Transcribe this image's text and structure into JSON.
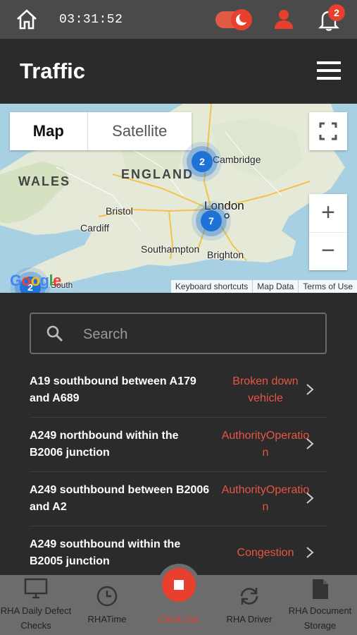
{
  "status_bar": {
    "time": "03:31:52",
    "notification_count": "2"
  },
  "header": {
    "title": "Traffic"
  },
  "map": {
    "tabs": [
      "Map",
      "Satellite"
    ],
    "labels": {
      "wales": "WALES",
      "england": "ENGLAND",
      "cambridge": "Cambridge",
      "london": "London",
      "bristol": "Bristol",
      "cardiff": "Cardiff",
      "southampton": "Southampton",
      "brighton": "Brighton",
      "south": "South"
    },
    "clusters": [
      "2",
      "7",
      "2"
    ],
    "attribution": [
      "Keyboard shortcuts",
      "Map Data",
      "Terms of Use"
    ],
    "logo": "Google"
  },
  "search": {
    "placeholder": "Search"
  },
  "incidents": [
    {
      "road": "A19 southbound between A179 and A689",
      "status": "Broken down vehicle"
    },
    {
      "road": "A249 northbound within the B2006 junction",
      "status": "AuthorityOperation"
    },
    {
      "road": "A249 southbound between B2006 and A2",
      "status": "AuthorityOperation"
    },
    {
      "road": "A249 southbound within the B2005 junction",
      "status": "Congestion"
    }
  ],
  "tabbar": {
    "daily_checks": "RHA Daily Defect Checks",
    "rhatime": "RHATime",
    "clock_out": "Clock Out",
    "driver": "RHA Driver",
    "documents": "RHA Document Storage"
  },
  "colors": {
    "accent": "#e8402e",
    "status_text": "#e65642",
    "map_cluster": "#1f73d6"
  }
}
